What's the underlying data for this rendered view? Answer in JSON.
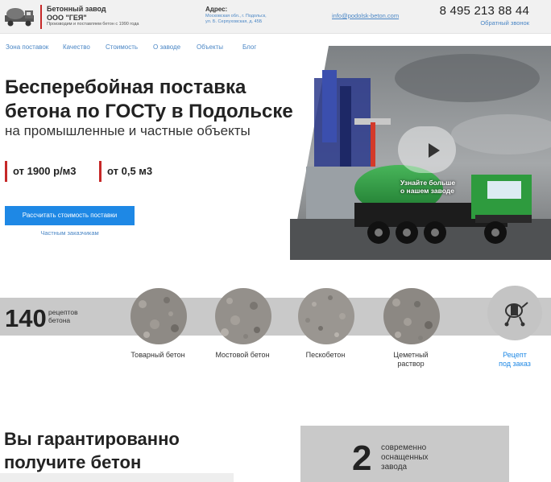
{
  "header": {
    "company_name_line1": "Бетонный завод",
    "company_name_line2": "ООО \"ГЕЯ\"",
    "company_tagline": "Производим и поставляем бетон с 1990 года",
    "address_label": "Адрес:",
    "address_line1": "Московская обл., г. Подольск,",
    "address_line2": "ул. Б. Серпуховская, д. 45Б",
    "email": "info@podolsk-beton.com",
    "phone": "8 495 213 88 44",
    "callback_label": "Обратный звонок"
  },
  "nav": {
    "items": [
      {
        "label": "Зона поставок"
      },
      {
        "label": "Качество"
      },
      {
        "label": "Стоимость"
      },
      {
        "label": "О заводе"
      },
      {
        "label": "Объекты"
      },
      {
        "label": "Блог"
      }
    ]
  },
  "hero": {
    "title_line1": "Бесперебойная поставка",
    "title_line2": "бетона по ГОСТу в Подольске",
    "subtitle": "на промышленные и частные объекты",
    "price_label": "от 1900 р/м3",
    "min_volume_label": "от 0,5 м3",
    "cta_label": "Рассчитать стоимость поставки",
    "private_link": "Частным заказчикам",
    "video_caption_line1": "Узнайте больше",
    "video_caption_line2": "о нашем заводе"
  },
  "recipes": {
    "count": "140",
    "count_label_line1": "рецептов",
    "count_label_line2": "бетона",
    "items": [
      {
        "line1": "Товарный бетон",
        "line2": ""
      },
      {
        "line1": "Мостовой бетон",
        "line2": ""
      },
      {
        "line1": "Пескобетон",
        "line2": ""
      },
      {
        "line1": "Цеметный",
        "line2": "раствор"
      }
    ],
    "custom_line1": "Рецепт",
    "custom_line2": "под заказ"
  },
  "bottom": {
    "title_line1": "Вы гарантированно",
    "title_line2": "получите бетон",
    "plants_count": "2",
    "plants_line1": "современно",
    "plants_line2": "оснащенных",
    "plants_line3": "завода"
  },
  "colors": {
    "accent_red": "#c62828",
    "link_blue": "#4a86c5",
    "button_blue": "#1e88e5",
    "band_gray": "#c9c9c9",
    "truck_green": "#2e9b3e"
  }
}
